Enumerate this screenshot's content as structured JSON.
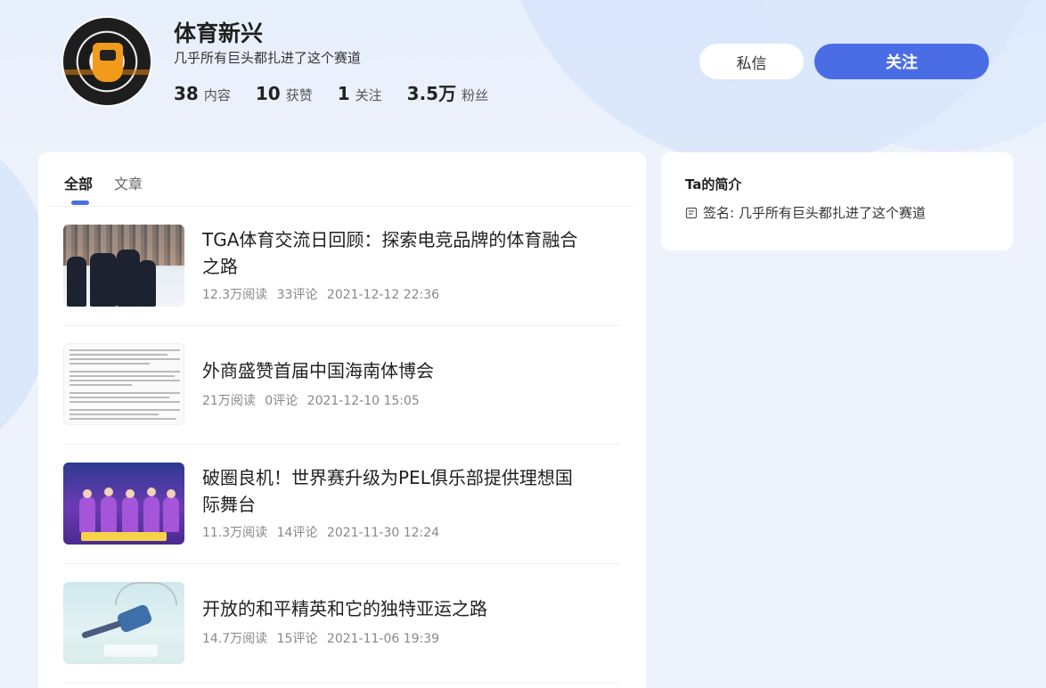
{
  "profile": {
    "name": "体育新兴",
    "bio": "几乎所有巨头都扎进了这个赛道",
    "stats": [
      {
        "num": "38",
        "label": "内容"
      },
      {
        "num": "10",
        "label": "获赞"
      },
      {
        "num": "1",
        "label": "关注"
      },
      {
        "num": "3.5万",
        "label": "粉丝"
      }
    ],
    "message_label": "私信",
    "follow_label": "关注"
  },
  "tabs": [
    {
      "label": "全部",
      "active": true
    },
    {
      "label": "文章",
      "active": false
    }
  ],
  "articles": [
    {
      "title": "TGA体育交流日回顾：探索电竞品牌的体育融合之路",
      "reads": "12.3万阅读",
      "comments": "33评论",
      "time": "2021-12-12 22:36",
      "thumb": "snow-group-photo"
    },
    {
      "title": "外商盛赞首届中国海南体博会",
      "reads": "21万阅读",
      "comments": "0评论",
      "time": "2021-12-10 15:05",
      "thumb": "text-document"
    },
    {
      "title": "破圈良机！世界赛升级为PEL俱乐部提供理想国际舞台",
      "reads": "11.3万阅读",
      "comments": "14评论",
      "time": "2021-11-30 12:24",
      "thumb": "esports-team"
    },
    {
      "title": "开放的和平精英和它的独特亚运之路",
      "reads": "14.7万阅读",
      "comments": "15评论",
      "time": "2021-11-06 19:39",
      "thumb": "parachute-poster"
    }
  ],
  "side": {
    "title": "Ta的简介",
    "signature": "签名: 几乎所有巨头都扎进了这个赛道"
  },
  "colors": {
    "accent": "#4a6de5",
    "background": "#eef3fb"
  }
}
